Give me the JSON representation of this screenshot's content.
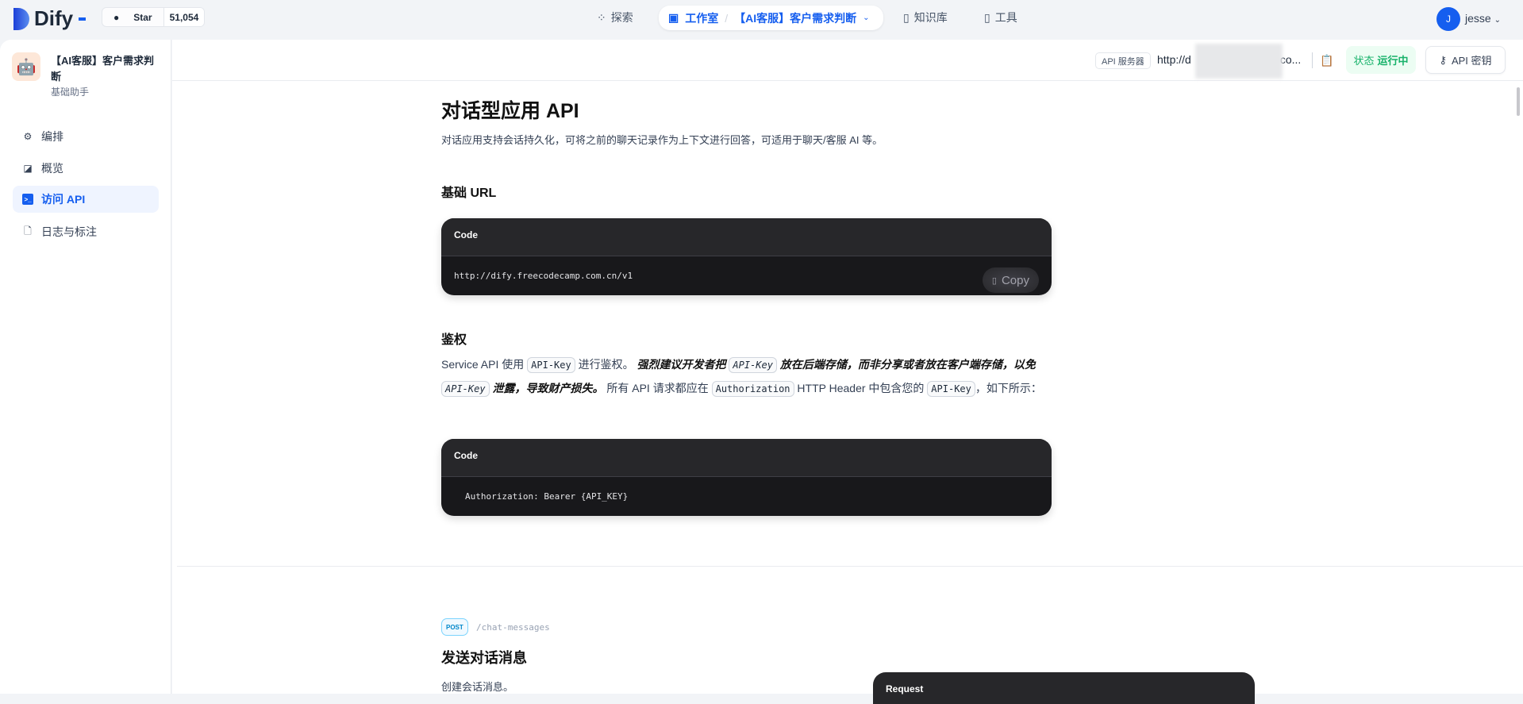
{
  "topnav": {
    "brand": "Dify",
    "star_label": "Star",
    "star_count": "51,054",
    "explore": "探索",
    "studio": "工作室",
    "current_app": "【AI客服】客户需求判断",
    "knowledge": "知识库",
    "tools": "工具",
    "user_initial": "J",
    "user_name": "jesse"
  },
  "sidebar": {
    "app_title": "【AI客服】客户需求判断",
    "app_type": "基础助手",
    "items": [
      {
        "label": "编排",
        "icon": "gear-icon"
      },
      {
        "label": "概览",
        "icon": "chart-icon"
      },
      {
        "label": "访问 API",
        "icon": "terminal-icon",
        "active": true
      },
      {
        "label": "日志与标注",
        "icon": "file-icon"
      }
    ]
  },
  "header": {
    "server_tag": "API 服务器",
    "server_url": "http://d",
    "server_url_end": "co...",
    "status_label": "状态",
    "status_value": "运行中",
    "api_key_button": "API 密钥"
  },
  "doc": {
    "title": "对话型应用 API",
    "description": "对话应用支持会话持久化，可将之前的聊天记录作为上下文进行回答，可适用于聊天/客服 AI 等。",
    "base_url_heading": "基础 URL",
    "code_label": "Code",
    "base_url": "http://dify.freecodecamp.com.cn/v1",
    "copy": "Copy",
    "auth_heading": "鉴权",
    "auth_p1": "Service API 使用 ",
    "auth_code1": "API-Key",
    "auth_p2": " 进行鉴权。 ",
    "auth_b1": "强烈建议开发者把 ",
    "auth_code2": "API-Key",
    "auth_b2": " 放在后端存储，而非分享或者放在客户端存储，以免 ",
    "auth_code3": "API-Key",
    "auth_b3": " 泄露，导致财产损失。",
    "auth_p3": " 所有 API 请求都应在 ",
    "auth_code4": "Authorization",
    "auth_p4": " HTTP Header 中包含您的 ",
    "auth_code5": "API-Key",
    "auth_p5": "，如下所示：",
    "auth_code": "Authorization: Bearer {API_KEY}",
    "method": "POST",
    "endpoint": "/chat-messages",
    "endpoint_title": "发送对话消息",
    "endpoint_desc": "创建会话消息。",
    "request_label": "Request"
  }
}
